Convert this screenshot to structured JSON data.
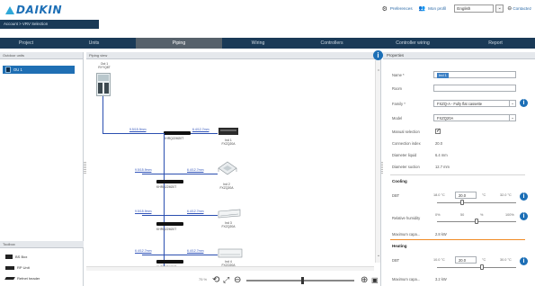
{
  "app": {
    "brand": "DAIKIN"
  },
  "breadcrumb": {
    "items": [
      "Account",
      "VRV Selection"
    ],
    "separator": ">"
  },
  "toplinks": {
    "preferences": "Preferences",
    "profile": "Mon profil",
    "language": "English",
    "contact": "Contactez"
  },
  "tabs": [
    {
      "label": "Project"
    },
    {
      "label": "Units"
    },
    {
      "label": "Piping",
      "active": true
    },
    {
      "label": "Wiring"
    },
    {
      "label": "Controllers"
    },
    {
      "label": "Controller wiring"
    },
    {
      "label": "Report"
    }
  ],
  "left": {
    "outdoor_header": "Outdoor units",
    "outdoor_item": "OU 1",
    "library_header": "Toolbox",
    "library_items": [
      {
        "label": "BS Box",
        "icon": "bs-box-icon"
      },
      {
        "label": "RP Unit",
        "icon": "rp-unit-icon"
      },
      {
        "label": "Refnet header",
        "icon": "refnet-header-icon"
      }
    ]
  },
  "drawing": {
    "header": "Piping view",
    "outdoor_label": "Out 1\nRYYQ8T",
    "pipe_labels": [
      "9.5/15.9mm",
      "6.4/12.7mm",
      "9.5/15.9mm",
      "6.4/12.7mm",
      "9.5/15.9mm",
      "6.4/12.7mm",
      "6.4/12.7mm",
      "6.4/12.7mm"
    ],
    "refnets": [
      "KHRQ22M20T",
      "KHRQ22M20T",
      "KHRQ22M20T",
      "KHRQ22M20T"
    ],
    "units": [
      {
        "label": "Ind 1\nFXZQ20A"
      },
      {
        "label": "Ind 2\nFXZQ20A"
      },
      {
        "label": "Ind 3\nFXZQ20A"
      },
      {
        "label": "Ind 4\nFXZQ20A"
      }
    ],
    "zoom_label": "75 %"
  },
  "props": {
    "header": "Properties",
    "name_label": "Name *",
    "name_value": "Ind 1",
    "room_label": "Room",
    "room_value": "",
    "family_label": "Family *",
    "family_value": "FXZQ-A - Fully flat cassette",
    "model_label": "Model",
    "model_value": "FXZQ20A",
    "manual_label": "Manual selection",
    "manual_checked": true,
    "connection_label": "Connection index",
    "connection_value": "20.0",
    "diam_liquid_label": "Diameter liquid",
    "diam_liquid_value": "6.4 mm",
    "diam_suction_label": "Diameter suction",
    "diam_suction_value": "12.7 mm",
    "cooling_header": "Cooling",
    "cool_db_label": "DBT",
    "cool_min": "18.0 °C",
    "cool_value": "20.0",
    "cool_unit": "°C",
    "cool_max": "32.0 °C",
    "cool_rh_label": "Relative humidity",
    "rh_min": "0%",
    "rh_value": "50",
    "rh_unit": "%",
    "rh_max": "100%",
    "cool_cap_label": "Maximum capa...",
    "cool_cap_value": "2.8 kW",
    "heating_header": "Heating",
    "heat_db_label": "DBT",
    "heat_min": "10.0 °C",
    "heat_value": "20.0",
    "heat_unit": "°C",
    "heat_max": "30.0 °C",
    "heat_cap_label": "Maximum capa...",
    "heat_cap_value": "3.2 kW"
  },
  "colors": {
    "navy": "#1a3a57",
    "accent": "#1d6fb6",
    "pipe": "#2b4fb0",
    "orange": "#f08a24"
  }
}
